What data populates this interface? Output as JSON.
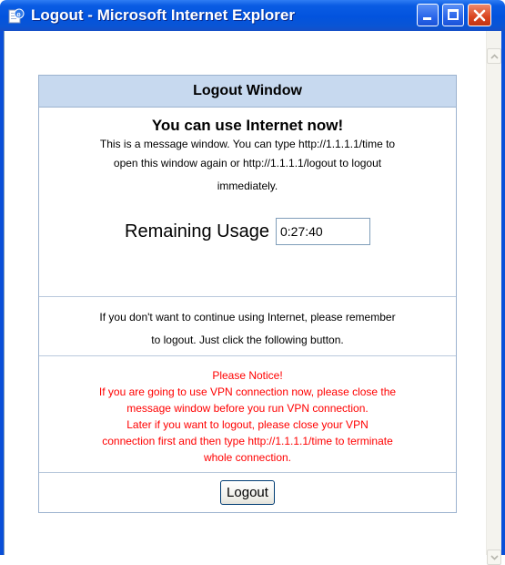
{
  "window": {
    "title": "Logout - Microsoft Internet Explorer",
    "icon": "ie-page-icon",
    "controls": [
      "minimize-icon",
      "maximize-icon",
      "close-icon"
    ]
  },
  "panel": {
    "header": "Logout Window",
    "headline": "You can use Internet now!",
    "info_line1": "This is a message window. You can type http://1.1.1.1/time to",
    "info_line2": "open this window again or http://1.1.1.1/logout to logout",
    "info_line3": "immediately.",
    "usage_label": "Remaining Usage",
    "usage_value": "0:27:40",
    "hint_line1": "If you don't want to continue using Internet, please remember",
    "hint_line2": "to logout. Just click the following button.",
    "notice": {
      "title": "Please Notice!",
      "line1": "If you are going to use VPN connection now, please close the",
      "line2": "message window before you run VPN connection.",
      "line3": "Later if you want to logout, please close your VPN",
      "line4": "connection first and then type http://1.1.1.1/time to terminate",
      "line5": "whole connection."
    },
    "button_label": "Logout"
  },
  "colors": {
    "titlebar": "#0253de",
    "header_bg": "#c7d9ef",
    "notice_text": "#ff0000",
    "close_button": "#d9441f"
  }
}
